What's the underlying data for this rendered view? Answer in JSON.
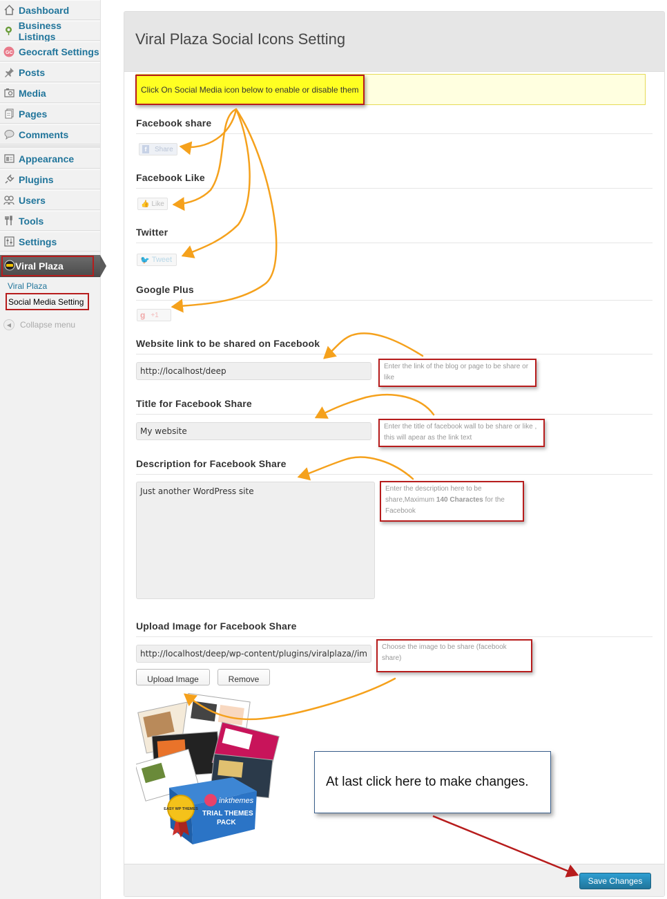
{
  "sidebar": {
    "items": [
      {
        "label": "Dashboard",
        "icon": "dashboard-icon"
      },
      {
        "label": "Business Listings",
        "icon": "map-pin-icon"
      },
      {
        "label": "Geocraft Settings",
        "icon": "geocraft-icon"
      },
      {
        "label": "Posts",
        "icon": "pushpin-icon"
      },
      {
        "label": "Media",
        "icon": "media-icon"
      },
      {
        "label": "Pages",
        "icon": "pages-icon"
      },
      {
        "label": "Comments",
        "icon": "comment-bubble-icon"
      },
      {
        "label": "Appearance",
        "icon": "appearance-icon"
      },
      {
        "label": "Plugins",
        "icon": "plugin-icon"
      },
      {
        "label": "Users",
        "icon": "users-icon"
      },
      {
        "label": "Tools",
        "icon": "tools-icon"
      },
      {
        "label": "Settings",
        "icon": "settings-icon"
      }
    ],
    "active_item": {
      "label": "Viral Plaza",
      "icon": "viral-plaza-icon"
    },
    "submenu": [
      "Viral Plaza",
      "Social Media Setting"
    ],
    "collapse_label": "Collapse menu"
  },
  "panel": {
    "title": "Viral Plaza Social Icons Setting",
    "notice": "Click On Social Media icon below to enable or disable them",
    "sections": {
      "fb_share": {
        "heading": "Facebook share",
        "button": "Share"
      },
      "fb_like": {
        "heading": "Facebook Like",
        "button": "Like"
      },
      "twitter": {
        "heading": "Twitter",
        "button": "Tweet"
      },
      "gplus": {
        "heading": "Google Plus",
        "button": "+1"
      }
    },
    "fields": {
      "link": {
        "heading": "Website link to be shared on Facebook",
        "value": "http://localhost/deep",
        "hint": "Enter the link of the blog or page to be share or like"
      },
      "title": {
        "heading": "Title for Facebook Share",
        "value": "My website",
        "hint": "Enter the title of facebook wall to be share or like , this will apear as the link text"
      },
      "description": {
        "heading": "Description for Facebook Share",
        "value": "Just another WordPress site",
        "hint_pre": "Enter the description here to be share,Maximum ",
        "hint_bold": "140 Charactes",
        "hint_post": " for the Facebook"
      },
      "image": {
        "heading": "Upload Image for Facebook Share",
        "value": "http://localhost/deep/wp-content/plugins/viralplaza//im",
        "hint": "Choose the image to be share (facebook share)",
        "upload_label": "Upload Image",
        "remove_label": "Remove"
      }
    },
    "promo": {
      "brand": "inkthemes",
      "seal": "EASY WP THEMES",
      "box_line1": "TRIAL THEMES",
      "box_line2": "PACK"
    },
    "callout": "At last click here to make changes.",
    "save_label": "Save Changes"
  },
  "colors": {
    "link_blue": "#21759b",
    "annotation_red": "#b71c1c",
    "arrow_orange": "#f5a11c",
    "highlight_yellow": "#ffff22",
    "save_blue": "#21759b"
  }
}
